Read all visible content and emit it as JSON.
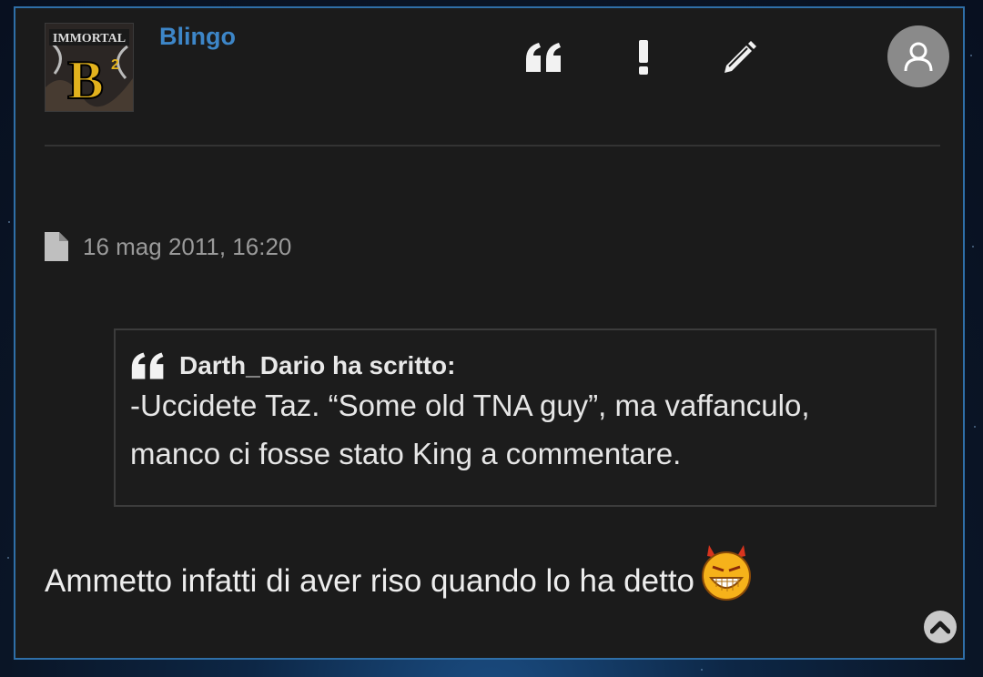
{
  "post": {
    "username": "Blingo",
    "avatar_caption": "IMMORTAL B²",
    "date": "16 mag 2011, 16:20",
    "quote": {
      "author_line": "Darth_Dario ha scritto:",
      "line1": "-Uccidete Taz. “Some old TNA guy”, ma vaffanculo,",
      "line2": "manco ci fosse stato King a commentare."
    },
    "message": "Ammetto infatti di aver riso quando lo ha detto"
  },
  "icons": {
    "quote": "quote-icon",
    "report": "exclamation-icon",
    "edit": "pencil-icon",
    "user": "user-icon",
    "post_date": "file-icon",
    "emoji": "devil-grin-emoji-icon",
    "scroll": "chevron-up-icon"
  },
  "colors": {
    "username": "#3d86c8",
    "post_border": "#2f6fa8",
    "post_bg": "#1b1b1b"
  }
}
